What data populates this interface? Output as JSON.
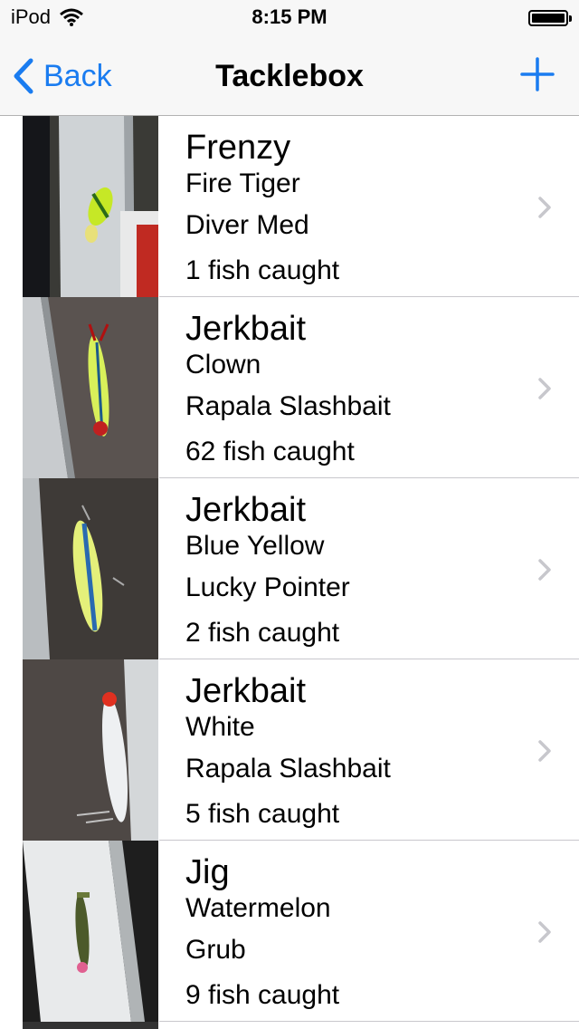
{
  "status_bar": {
    "carrier": "iPod",
    "time": "8:15 PM"
  },
  "nav": {
    "back_label": "Back",
    "title": "Tacklebox"
  },
  "items": [
    {
      "title": "Frenzy",
      "color": "Fire Tiger",
      "model": "Diver Med",
      "caught": "1 fish caught"
    },
    {
      "title": "Jerkbait",
      "color": "Clown",
      "model": "Rapala Slashbait",
      "caught": "62 fish caught"
    },
    {
      "title": "Jerkbait",
      "color": "Blue Yellow",
      "model": "Lucky Pointer",
      "caught": "2 fish caught"
    },
    {
      "title": "Jerkbait",
      "color": "White",
      "model": "Rapala Slashbait",
      "caught": "5 fish caught"
    },
    {
      "title": "Jig",
      "color": "Watermelon",
      "model": "Grub",
      "caught": "9 fish caught"
    }
  ],
  "colors": {
    "accent": "#1a7cf0",
    "separator": "#c8c7cc",
    "bar": "#f7f7f7"
  }
}
